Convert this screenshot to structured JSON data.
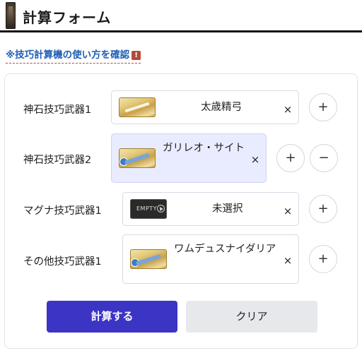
{
  "header": {
    "title": "計算フォーム",
    "icon": "pillar-icon"
  },
  "help": {
    "prefix": "※",
    "link_text": "技巧計算機の使い方を確認",
    "badge": "!"
  },
  "rows": [
    {
      "label": "神石技巧武器1",
      "weapon": "太歳精弓",
      "remove": "×",
      "buttons": [
        "+"
      ]
    },
    {
      "label": "神石技巧武器2",
      "weapon": "ガリレオ・サイト",
      "remove": "×",
      "buttons": [
        "+",
        "−"
      ],
      "selected": true
    },
    {
      "label": "マグナ技巧武器1",
      "weapon": "未選択",
      "thumb_text": "EMPTY",
      "remove": "×",
      "buttons": [
        "+"
      ]
    },
    {
      "label": "その他技巧武器1",
      "weapon": "ワムデュスナイダリア",
      "remove": "×",
      "buttons": [
        "+"
      ]
    }
  ],
  "actions": {
    "calc_label": "計算する",
    "clear_label": "クリア"
  },
  "colors": {
    "primary": "#3c34c4",
    "link": "#1f5fb5",
    "selected_bg": "#e9ecff",
    "accent": "#b24a3a"
  }
}
